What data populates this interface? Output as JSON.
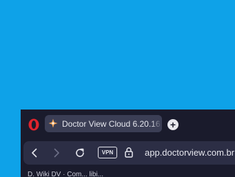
{
  "tab": {
    "title": "Doctor View Cloud 6.20.16"
  },
  "navbar": {
    "vpn_label": "VPN",
    "url": "app.doctorview.com.br"
  },
  "bookmarks": {
    "text": "D. Wiki DV · Com... libi..."
  },
  "icons": {
    "browser_logo": "opera-logo-icon",
    "tab_favicon": "doctorview-favicon-icon",
    "new_tab": "plus-icon",
    "back": "arrow-left-icon",
    "forward": "arrow-right-icon",
    "reload": "reload-icon",
    "lock": "lock-icon"
  },
  "colors": {
    "desktop": "#0ea2e8",
    "browser_chrome": "#1a1b2c",
    "active_tab": "#3b3e55",
    "address_bar": "#2c2e45",
    "opera_red": "#e0242d"
  }
}
